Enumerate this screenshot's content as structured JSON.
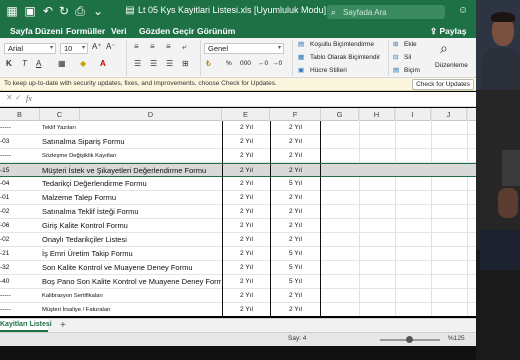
{
  "app": {
    "title": "Lt 05 Kys Kayitlari Listesi.xls  [Uyumluluk Modu]",
    "search_placeholder": "Sayfada Ara",
    "share_label": "Paylaş",
    "menu": [
      "Sayfa Düzeni",
      "Formüller",
      "Veri",
      "Gözden Geçir",
      "Görünüm"
    ]
  },
  "ribbon": {
    "font_name": "Arial",
    "font_size": "10",
    "number_format": "Genel",
    "cond_format_label": "Koşullu Biçimlendirme",
    "table_format_label": "Tablo Olarak Biçimlendir",
    "cell_styles_label": "Hücre Stilleri",
    "insert_label": "Ekle",
    "delete_label": "Sil",
    "format_label": "Biçim",
    "edit_label": "Düzenleme",
    "percent_label": "%",
    "thousands_label": "000",
    "bold_label": "K",
    "italic_label": "T",
    "underline_label": "A",
    "font_color_label": "A"
  },
  "infobar": {
    "message": "To keep up-to-date with security updates, fixes, and improvements, choose Check for Updates.",
    "button": "Check for Updates"
  },
  "formula_bar": {
    "fx": "fx"
  },
  "columns": [
    "B",
    "C",
    "D",
    "E",
    "F",
    "G",
    "H",
    "I",
    "J"
  ],
  "rows": [
    {
      "b": "-----",
      "name": "Teklif Yazıları",
      "size": "small",
      "e": "2 Yıl",
      "f": "2 Yıl"
    },
    {
      "b": "-03",
      "name": "Satınalma Sipariş Formu",
      "size": "big",
      "e": "2 Yıl",
      "f": "2 Yıl"
    },
    {
      "b": "-----",
      "name": "Sözleşme Değişiklik Kayıtları",
      "size": "small",
      "e": "2 Yıl",
      "f": "2 Yıl"
    },
    {
      "b": "-15",
      "name": "Müşteri İstek ve Şikayetleri Değerlendirme Formu",
      "size": "big",
      "e": "2 Yıl",
      "f": "2 Yıl"
    },
    {
      "b": "-04",
      "name": "Tedarikçi Değerlendirme Formu",
      "size": "big",
      "e": "2 Yıl",
      "f": "5 Yıl"
    },
    {
      "b": "-01",
      "name": "Malzeme Talep Formu",
      "size": "big",
      "e": "2 Yıl",
      "f": "2 Yıl"
    },
    {
      "b": "-02",
      "name": "Satınalma Teklif İsteği Formu",
      "size": "big",
      "e": "2 Yıl",
      "f": "2 Yıl"
    },
    {
      "b": "-06",
      "name": "Giriş Kalite Kontrol Formu",
      "size": "big",
      "e": "2 Yıl",
      "f": "2 Yıl"
    },
    {
      "b": "-02",
      "name": "Onaylı Tedarikçiler Listesi",
      "size": "big",
      "e": "2 Yıl",
      "f": "2 Yıl"
    },
    {
      "b": "-21",
      "name": "İş Emri Üretim Takip Formu",
      "size": "big",
      "e": "2 Yıl",
      "f": "5 Yıl"
    },
    {
      "b": "-32",
      "name": "Son Kalite Kontrol ve Muayene Deney Formu",
      "size": "big",
      "e": "2 Yıl",
      "f": "5 Yıl"
    },
    {
      "b": "-40",
      "name": "Boş Pano Son Kalite Kontrol ve Muayene Deney Formu",
      "size": "big",
      "e": "2 Yıl",
      "f": "5 Yıl"
    },
    {
      "b": "-----",
      "name": "Kalibrasyon Sertifikaları",
      "size": "small",
      "e": "2 Yıl",
      "f": "2 Yıl"
    },
    {
      "b": "-----",
      "name": "Müşteri İrsaliye / Faturaları",
      "size": "small",
      "e": "2 Yıl",
      "f": "2 Yıl"
    }
  ],
  "selected_row": 3,
  "sheet_tab": "Kayitları Listesi",
  "status": {
    "count": "Say: 4",
    "zoom": "%125"
  },
  "colors": {
    "accent": "#1e7145",
    "selected_row": "#d9d9d9",
    "infobar": "#fbf6de"
  }
}
